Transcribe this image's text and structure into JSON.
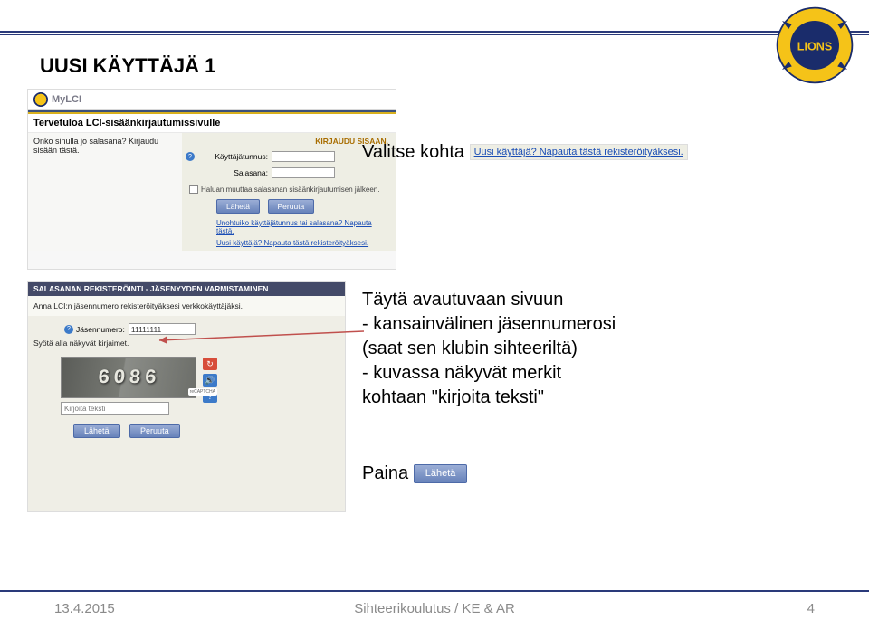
{
  "slide_title": "UUSI KÄYTTÄJÄ 1",
  "mylci": {
    "brand": "MyLCI",
    "welcome": "Tervetuloa LCI-sisäänkirjautumissivulle",
    "left_question": "Onko sinulla jo salasana? Kirjaudu sisään tästä.",
    "panel_title": "KIRJAUDU SISÄÄN.",
    "username_label": "Käyttäjätunnus:",
    "password_label": "Salasana:",
    "checkbox_label": "Haluan muuttaa salasanan sisäänkirjautumisen jälkeen.",
    "submit": "Lähetä",
    "cancel": "Peruuta",
    "forgot_link": "Unohtuiko käyttäjätunnus tai salasana? Napauta tästä.",
    "newuser_link": "Uusi käyttäjä? Napauta tästä rekisteröityäksesi."
  },
  "register": {
    "bar": "SALASANAN REKISTERÖINTI - JÄSENYYDEN VARMISTAMINEN",
    "instr": "Anna LCI:n jäsennumero rekisteröityäksesi verkkokäyttäjäksi.",
    "num_label": "Jäsennumero:",
    "num_value": "11111111",
    "type_letters": "Syötä alla näkyvät kirjaimet.",
    "captcha_text": "6086",
    "recaptcha": "reCAPTCHA",
    "text_placeholder": "Kirjoita teksti",
    "submit": "Lähetä",
    "cancel": "Peruuta"
  },
  "right": {
    "line1_a": "Valitse kohta",
    "link_snip": "Uusi käyttäjä? Napauta tästä rekisteröityäksesi.",
    "block2_l1": "Täytä avautuvaan sivuun",
    "block2_l2": "- kansainvälinen jäsennumerosi",
    "block2_l3": "(saat sen klubin sihteeriltä)",
    "block2_l4": "- kuvassa näkyvät merkit",
    "block2_l5": "kohtaan \"kirjoita teksti\"",
    "paina": "Paina",
    "btn_snip": "Lähetä"
  },
  "footer": {
    "date": "13.4.2015",
    "center": "Sihteerikoulutus / KE & AR",
    "page": "4"
  }
}
